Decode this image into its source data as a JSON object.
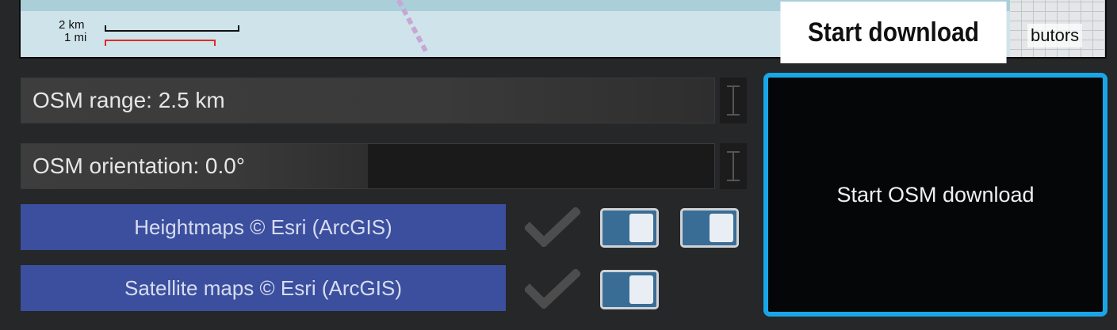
{
  "map": {
    "scale_km": "2 km",
    "scale_mi": "1 mi",
    "attribution_fragment": "butors"
  },
  "tooltip": {
    "text": "Start download"
  },
  "sliders": [
    {
      "label": "OSM range: 2.5 km",
      "fill_fraction": 1.0
    },
    {
      "label": "OSM orientation: 0.0°",
      "fill_fraction": 0.5
    }
  ],
  "providers": [
    {
      "label": "Heightmaps © Esri (ArcGIS)",
      "checked": true,
      "toggle_count": 2
    },
    {
      "label": "Satellite maps © Esri (ArcGIS)",
      "checked": true,
      "toggle_count": 1
    }
  ],
  "osm_button": {
    "label": "Start OSM download"
  },
  "colors": {
    "accent_border": "#1aa6e6",
    "provider_bg": "#3b4f9e",
    "toggle_bg": "#3a6d95",
    "panel_bg": "#262729"
  },
  "icons": [
    "checkmark-icon",
    "toggle-switch-icon",
    "slider-handle-icon"
  ]
}
